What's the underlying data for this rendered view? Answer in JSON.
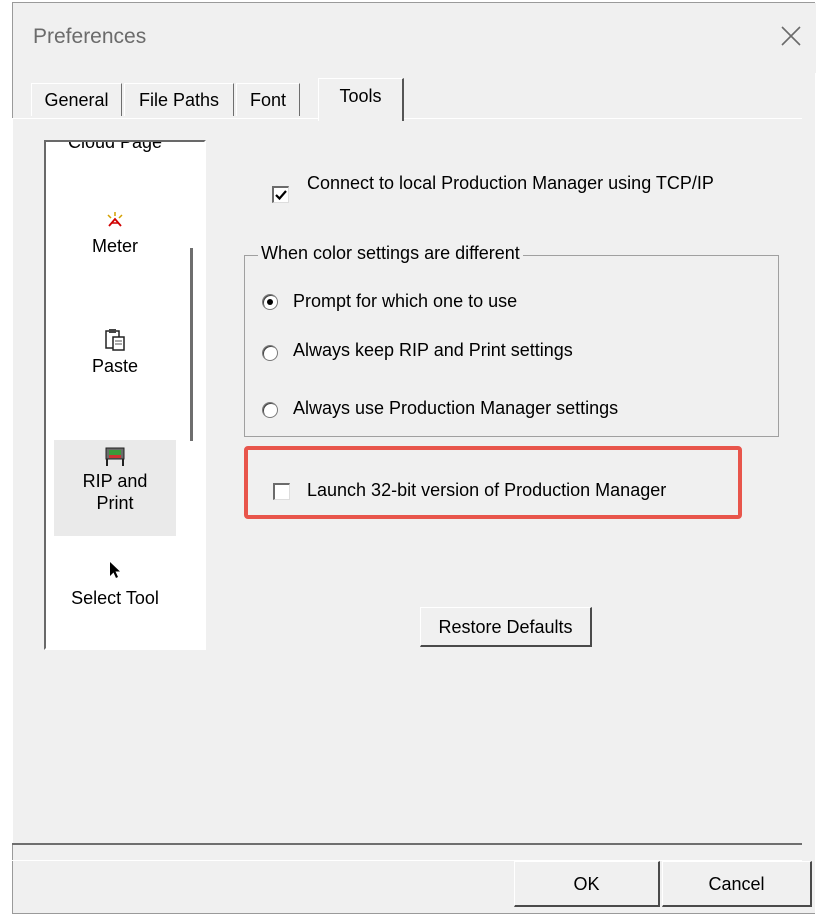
{
  "window": {
    "title": "Preferences"
  },
  "tabs": [
    {
      "label": "General",
      "active": false
    },
    {
      "label": "File Paths",
      "active": false
    },
    {
      "label": "Font",
      "active": false
    },
    {
      "label": "Tools",
      "active": true
    }
  ],
  "tool_list": {
    "items": [
      {
        "label": "Cloud Page",
        "icon": "cloud-page-icon"
      },
      {
        "label": "Meter",
        "icon": "meter-icon"
      },
      {
        "label": "Paste",
        "icon": "paste-icon"
      },
      {
        "label": "RIP and\nPrint",
        "icon": "rip-print-icon",
        "selected": true
      },
      {
        "label": "Select Tool",
        "icon": "select-tool-icon"
      }
    ]
  },
  "options": {
    "connect_local": {
      "label": "Connect to local Production Manager using TCP/IP",
      "checked": true
    },
    "color_group": {
      "legend": "When color settings are different",
      "choices": [
        {
          "label": "Prompt for which one to use",
          "selected": true
        },
        {
          "label": "Always keep RIP and Print settings",
          "selected": false
        },
        {
          "label": "Always use Production Manager settings",
          "selected": false
        }
      ]
    },
    "launch_32bit": {
      "label": "Launch 32-bit version of Production Manager",
      "checked": false
    }
  },
  "buttons": {
    "restore_defaults": "Restore Defaults",
    "ok": "OK",
    "cancel": "Cancel"
  },
  "colors": {
    "dialog_bg": "#f0f0f0",
    "highlight": "#e8554b"
  }
}
